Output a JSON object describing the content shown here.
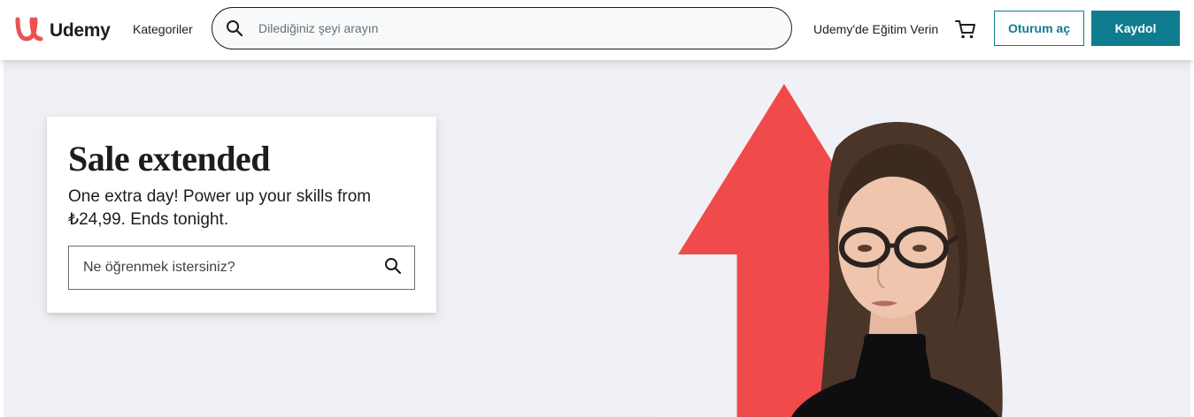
{
  "header": {
    "logo_text": "Udemy",
    "categories_label": "Kategoriler",
    "search_placeholder": "Dilediğiniz şeyi arayın",
    "teach_label": "Udemy'de Eğitim Verin",
    "login_label": "Oturum aç",
    "signup_label": "Kaydol",
    "icons": {
      "search": "search-icon",
      "cart": "cart-icon",
      "logo": "udemy-logo-icon"
    }
  },
  "hero": {
    "title": "Sale extended",
    "text": "One extra day! Power up your skills from ₺24,99. Ends tonight.",
    "search_placeholder": "Ne öğrenmek istersiniz?",
    "icons": {
      "search": "search-icon"
    }
  },
  "colors": {
    "brand_red": "#ea5252",
    "accent_teal": "#0f7c90",
    "text_dark": "#1c1d1f",
    "hero_bg": "#eff0f5",
    "arrow_red": "#f04a4a"
  }
}
